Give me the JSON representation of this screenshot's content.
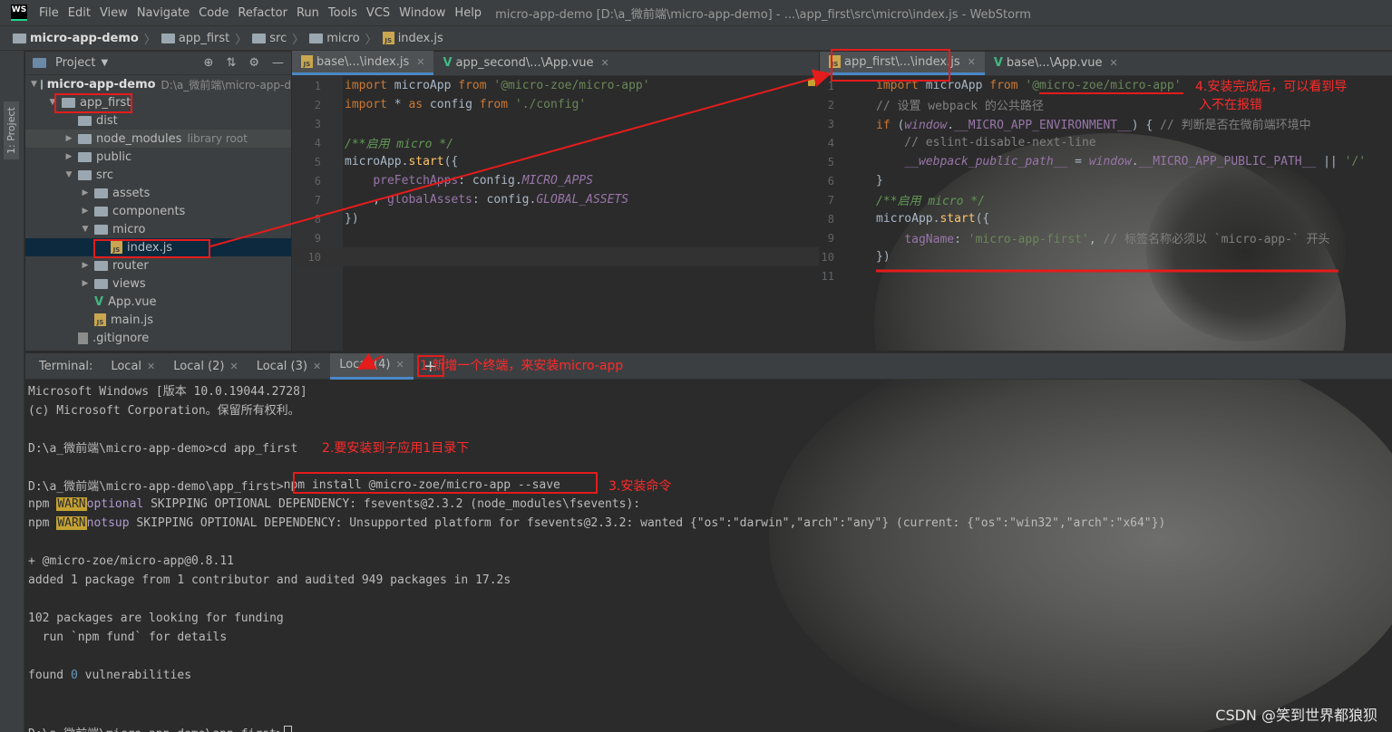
{
  "menu": {
    "items": [
      "File",
      "Edit",
      "View",
      "Navigate",
      "Code",
      "Refactor",
      "Run",
      "Tools",
      "VCS",
      "Window",
      "Help"
    ],
    "window_title": "micro-app-demo [D:\\a_微前端\\micro-app-demo] - ...\\app_first\\src\\micro\\index.js - WebStorm",
    "logo": "WS"
  },
  "breadcrumb": [
    "micro-app-demo",
    "app_first",
    "src",
    "micro",
    "index.js"
  ],
  "left_strip": {
    "label": "1: Project"
  },
  "project": {
    "title": "Project",
    "tree": [
      {
        "label": "micro-app-demo",
        "hint": "D:\\a_微前端\\micro-app-d",
        "depth": 0,
        "arrow": "down",
        "icon": "folder-icon",
        "bold": true
      },
      {
        "label": "app_first",
        "depth": 1,
        "arrow": "down",
        "icon": "folder-icon"
      },
      {
        "label": "dist",
        "depth": 2,
        "arrow": "",
        "icon": "folder-icon"
      },
      {
        "label": "node_modules",
        "hint": "library root",
        "depth": 2,
        "arrow": "right",
        "icon": "folder-icon",
        "lib": true
      },
      {
        "label": "public",
        "depth": 2,
        "arrow": "right",
        "icon": "folder-icon"
      },
      {
        "label": "src",
        "depth": 2,
        "arrow": "down",
        "icon": "folder-icon"
      },
      {
        "label": "assets",
        "depth": 3,
        "arrow": "right",
        "icon": "folder-icon"
      },
      {
        "label": "components",
        "depth": 3,
        "arrow": "right",
        "icon": "folder-icon"
      },
      {
        "label": "micro",
        "depth": 3,
        "arrow": "down",
        "icon": "folder-icon"
      },
      {
        "label": "index.js",
        "depth": 4,
        "arrow": "",
        "icon": "js-file-icon",
        "selected": true
      },
      {
        "label": "router",
        "depth": 3,
        "arrow": "right",
        "icon": "folder-icon"
      },
      {
        "label": "views",
        "depth": 3,
        "arrow": "right",
        "icon": "folder-icon"
      },
      {
        "label": "App.vue",
        "depth": 3,
        "arrow": "",
        "icon": "vue-file-icon"
      },
      {
        "label": "main.js",
        "depth": 3,
        "arrow": "",
        "icon": "js-file-icon"
      },
      {
        "label": ".gitignore",
        "depth": 2,
        "arrow": "",
        "icon": "file-icon"
      }
    ]
  },
  "editor1": {
    "tabs": [
      {
        "label": "base\\...\\index.js",
        "icon": "js-file-icon",
        "active": true
      },
      {
        "label": "app_second\\...\\App.vue",
        "icon": "vue-file-icon",
        "active": false
      }
    ],
    "line_numbers": [
      "1",
      "2",
      "3",
      "4",
      "5",
      "6",
      "7",
      "8",
      "9",
      "10"
    ]
  },
  "editor2": {
    "tabs": [
      {
        "label": "app_first\\...\\index.js",
        "icon": "js-file-icon",
        "active": true
      },
      {
        "label": "base\\...\\App.vue",
        "icon": "vue-file-icon",
        "active": false
      }
    ],
    "line_numbers": [
      "1",
      "2",
      "3",
      "4",
      "5",
      "6",
      "7",
      "8",
      "9",
      "10",
      "11"
    ]
  },
  "terminal": {
    "label": "Terminal:",
    "tabs": [
      "Local",
      "Local (2)",
      "Local (3)",
      "Local (4)"
    ],
    "add_label": "+",
    "lines": {
      "l1": "Microsoft Windows [版本 10.0.19044.2728]",
      "l2": "(c) Microsoft Corporation。保留所有权利。",
      "l3": "D:\\a_微前端\\micro-app-demo>cd app_first",
      "l4_prompt": "D:\\a_微前端\\micro-app-demo\\app_first>",
      "l4_cmd": "npm install @micro-zoe/micro-app --save",
      "l5_prefix": "npm ",
      "warn": "WARN",
      "l5_tag": "optional",
      "l5_rest": " SKIPPING OPTIONAL DEPENDENCY: fsevents@2.3.2 (node_modules\\fsevents):",
      "l6_tag": "notsup",
      "l6_rest": " SKIPPING OPTIONAL DEPENDENCY: Unsupported platform for fsevents@2.3.2: wanted {\"os\":\"darwin\",\"arch\":\"any\"} (current: {\"os\":\"win32\",\"arch\":\"x64\"})",
      "l7": "+ @micro-zoe/micro-app@0.8.11",
      "l8": "added 1 package from 1 contributor and audited 949 packages in 17.2s",
      "l9": "102 packages are looking for funding",
      "l10": "  run `npm fund` for details",
      "l11_pre": "found ",
      "l11_num": "0",
      "l11_post": " vulnerabilities",
      "l12": "D:\\a_微前端\\micro-app-demo\\app_first>"
    }
  },
  "annotations": {
    "note1": "1.新增一个终端，来安装micro-app",
    "note2": "2.要安装到子应用1目录下",
    "note3": "3.安装命令",
    "note4_line1": "4.安装完成后，可以看到导",
    "note4_line2": "入不在报错"
  },
  "watermark": "CSDN @笑到世界都狼狈",
  "colors": {
    "annotation_red": "#e41c1c",
    "keyword": "#cc7832",
    "string": "#6a8759",
    "warn_bg": "#c5a332"
  }
}
